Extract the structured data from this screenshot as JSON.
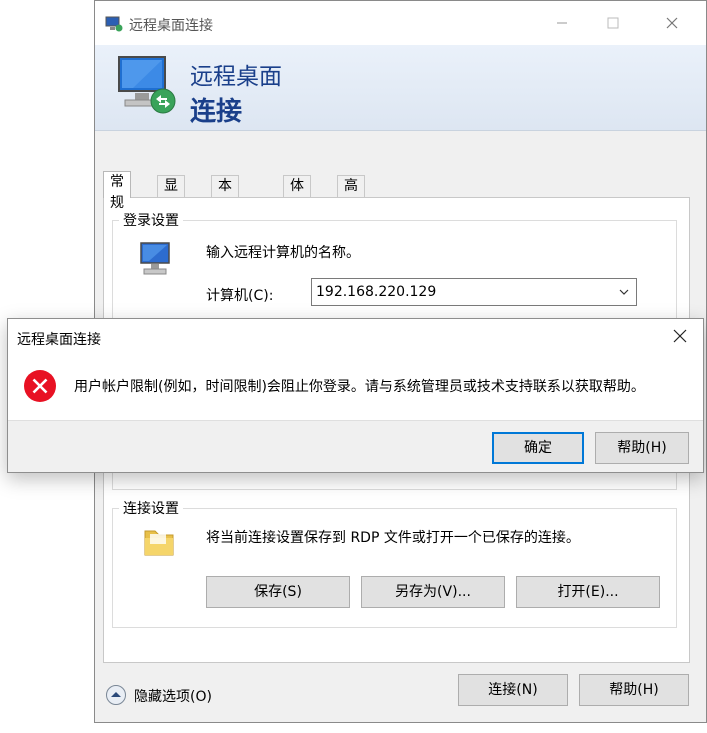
{
  "window": {
    "title": "远程桌面连接"
  },
  "banner": {
    "line1": "远程桌面",
    "line2": "连接"
  },
  "tabs": [
    {
      "label": "常规",
      "active": true
    },
    {
      "label": "显示"
    },
    {
      "label": "本地资源"
    },
    {
      "label": "体验"
    },
    {
      "label": "高级"
    }
  ],
  "login": {
    "group_label": "登录设置",
    "prompt": "输入远程计算机的名称。",
    "computer_label": "计算机(C):",
    "computer_value": "192.168.220.129"
  },
  "connection": {
    "group_label": "连接设置",
    "description": "将当前连接设置保存到 RDP 文件或打开一个已保存的连接。",
    "save_label": "保存(S)",
    "saveas_label": "另存为(V)...",
    "open_label": "打开(E)..."
  },
  "footer": {
    "hide_options_label": "隐藏选项(O)",
    "connect_label": "连接(N)",
    "help_label": "帮助(H)"
  },
  "dialog": {
    "title": "远程桌面连接",
    "message": "用户帐户限制(例如，时间限制)会阻止你登录。请与系统管理员或技术支持联系以获取帮助。",
    "ok_label": "确定",
    "help_label": "帮助(H)"
  },
  "colors": {
    "accent": "#0078d7",
    "banner_text": "#1a3f8a",
    "error_red": "#e81123"
  }
}
